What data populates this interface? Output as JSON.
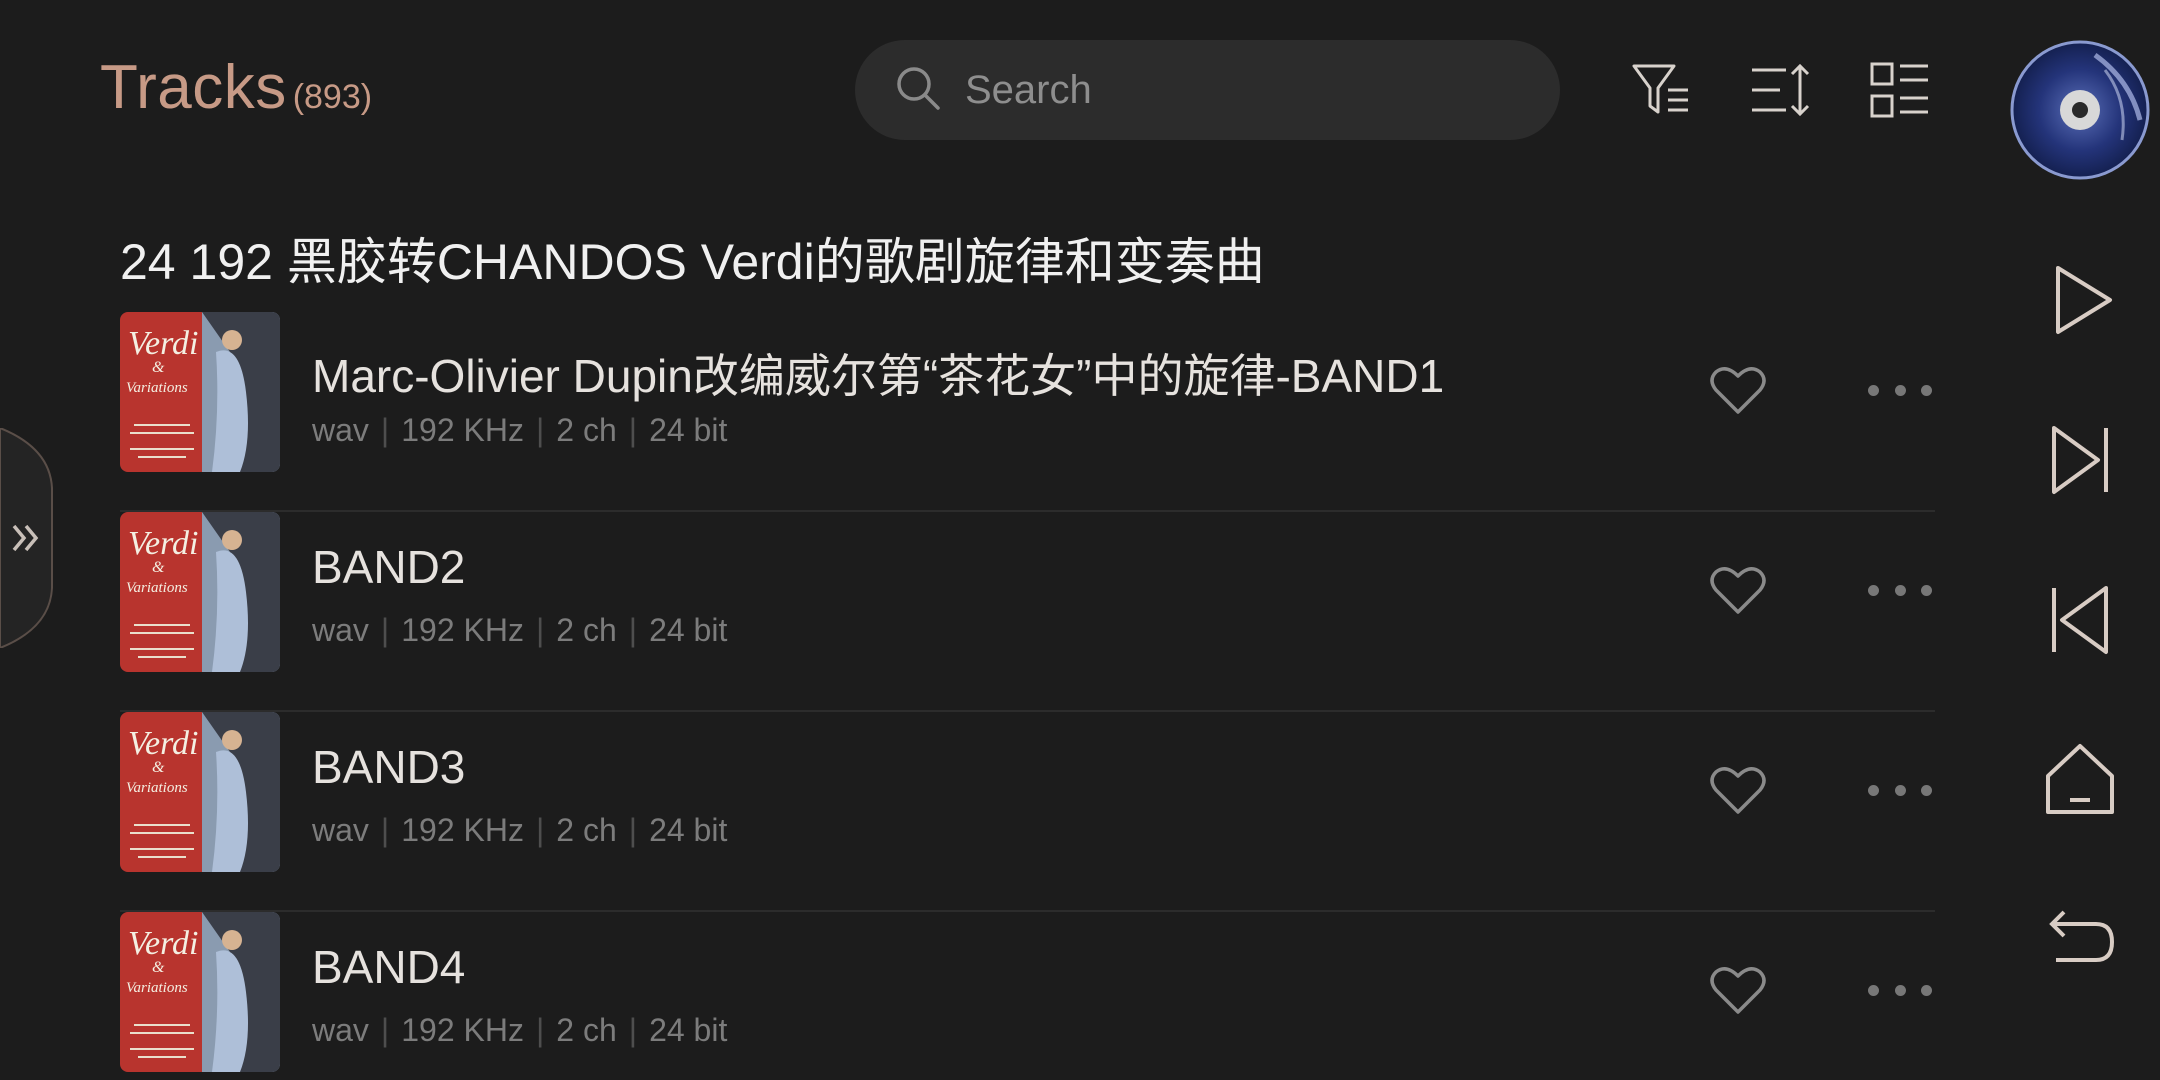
{
  "header": {
    "title": "Tracks",
    "count": "(893)",
    "search_placeholder": "Search"
  },
  "album": {
    "title": "24 192 黑胶转CHANDOS Verdi的歌剧旋律和变奏曲"
  },
  "tracks": [
    {
      "name": "Marc-Olivier Dupin改编威尔第“茶花女”中的旋律-BAND1",
      "format": "wav",
      "rate": "192 KHz",
      "channels": "2 ch",
      "bits": "24 bit"
    },
    {
      "name": "BAND2",
      "format": "wav",
      "rate": "192 KHz",
      "channels": "2 ch",
      "bits": "24 bit"
    },
    {
      "name": "BAND3",
      "format": "wav",
      "rate": "192 KHz",
      "channels": "2 ch",
      "bits": "24 bit"
    },
    {
      "name": "BAND4",
      "format": "wav",
      "rate": "192 KHz",
      "channels": "2 ch",
      "bits": "24 bit"
    }
  ],
  "cover_art": {
    "title": "Verdi",
    "amp": "&",
    "subtitle": "Variations"
  },
  "icons": {
    "search": "search-icon",
    "filter": "filter-icon",
    "sort": "sort-icon",
    "view": "list-view-icon",
    "disc": "now-playing-disc-icon",
    "play": "play-icon",
    "next": "next-icon",
    "previous": "previous-icon",
    "home": "home-icon",
    "back": "back-icon",
    "expand": "expand-chevrons-icon",
    "favorite": "heart-icon",
    "more": "more-icon"
  },
  "colors": {
    "accent": "#c79a86",
    "background": "#1c1c1c",
    "text": "#e6e2de",
    "meta": "#7c7c7c"
  }
}
